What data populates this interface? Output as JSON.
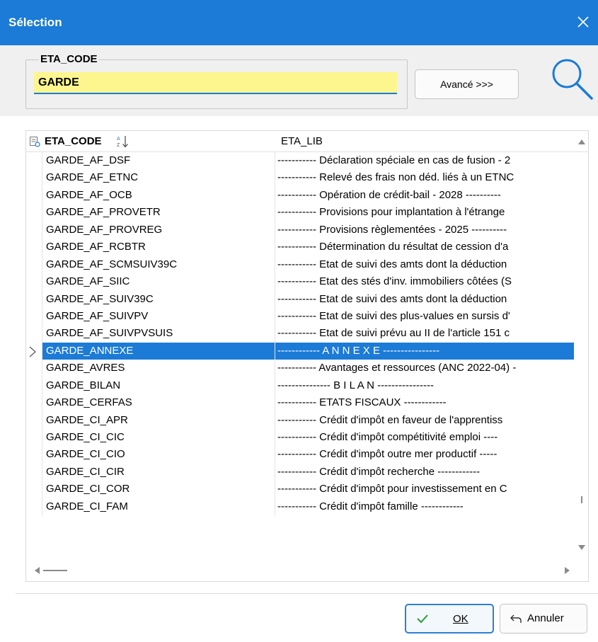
{
  "window": {
    "title": "Sélection"
  },
  "filter": {
    "legend": "ETA_CODE",
    "value": "GARDE",
    "advanced_label": "Avancé >>>"
  },
  "grid": {
    "columns": [
      {
        "key": "code",
        "label": "ETA_CODE",
        "sorted": "ascending"
      },
      {
        "key": "lib",
        "label": "ETA_LIB"
      }
    ],
    "selected_row": "GARDE_ANNEXE",
    "rows": [
      {
        "code": "GARDE_AF_DSF",
        "lib": "----------- Déclaration spéciale en cas de fusion  - 2"
      },
      {
        "code": "GARDE_AF_ETNC",
        "lib": "----------- Relevé des frais non déd. liés à un ETNC"
      },
      {
        "code": "GARDE_AF_OCB",
        "lib": "----------- Opération de crédit-bail - 2028 ----------"
      },
      {
        "code": "GARDE_AF_PROVETR",
        "lib": "----------- Provisions pour implantation à l'étrange"
      },
      {
        "code": "GARDE_AF_PROVREG",
        "lib": "----------- Provisions règlementées - 2025 ----------"
      },
      {
        "code": "GARDE_AF_RCBTR",
        "lib": "----------- Détermination du résultat de cession d'a"
      },
      {
        "code": "GARDE_AF_SCMSUIV39C",
        "lib": "----------- Etat de suivi des amts dont la déduction"
      },
      {
        "code": "GARDE_AF_SIIC",
        "lib": "----------- Etat des stés d'inv. immobiliers côtées (S"
      },
      {
        "code": "GARDE_AF_SUIV39C",
        "lib": "----------- Etat de suivi des amts dont la déduction"
      },
      {
        "code": "GARDE_AF_SUIVPV",
        "lib": "----------- Etat de suivi des plus-values en sursis d'"
      },
      {
        "code": "GARDE_AF_SUIVPVSUIS",
        "lib": "----------- Etat de suivi prévu au II de l'article 151 c"
      },
      {
        "code": "GARDE_ANNEXE",
        "lib": "------------   A N N E X E   ----------------"
      },
      {
        "code": "GARDE_AVRES",
        "lib": "----------- Avantages et ressources (ANC 2022-04)  -"
      },
      {
        "code": "GARDE_BILAN",
        "lib": "---------------    B I L A N   ----------------"
      },
      {
        "code": "GARDE_CERFAS",
        "lib": "----------- ETATS FISCAUX  ------------"
      },
      {
        "code": "GARDE_CI_APR",
        "lib": "----------- Crédit d'impôt en faveur de l'apprentiss"
      },
      {
        "code": "GARDE_CI_CIC",
        "lib": "----------- Crédit d'impôt compétitivité emploi  ----"
      },
      {
        "code": "GARDE_CI_CIO",
        "lib": "----------- Crédit d'impôt outre mer productif  -----"
      },
      {
        "code": "GARDE_CI_CIR",
        "lib": "----------- Crédit d'impôt recherche  ------------"
      },
      {
        "code": "GARDE_CI_COR",
        "lib": "----------- Crédit d'impôt pour investissement en C"
      },
      {
        "code": "GARDE_CI_FAM",
        "lib": "----------- Crédit d'impôt famille  ------------"
      }
    ]
  },
  "buttons": {
    "ok_label": "OK",
    "cancel_label": "Annuler"
  },
  "icons": {
    "close": "close-icon",
    "search": "search-icon",
    "sort": "sort-ascending-icon",
    "ok": "check-icon",
    "cancel": "undo-arrow-icon"
  },
  "colors": {
    "accent": "#1b7bd6",
    "input_highlight": "#fdf68e",
    "ok_check": "#2e9b36"
  }
}
